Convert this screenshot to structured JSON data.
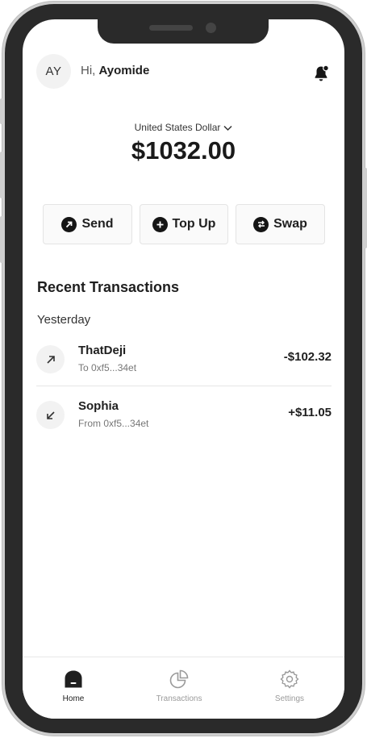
{
  "user": {
    "initials": "AY",
    "greeting_prefix": "Hi,",
    "name": "Ayomide"
  },
  "wallet": {
    "currency": "United States Dollar",
    "balance": "$1032.00"
  },
  "actions": [
    {
      "label": "Send",
      "icon": "arrow-up-right-icon"
    },
    {
      "label": "Top Up",
      "icon": "plus-icon"
    },
    {
      "label": "Swap",
      "icon": "swap-icon"
    }
  ],
  "transactions": {
    "title": "Recent Transactions",
    "group": "Yesterday",
    "items": [
      {
        "name": "ThatDeji",
        "detail": "To 0xf5...34et",
        "amount": "-$102.32",
        "direction": "outgoing"
      },
      {
        "name": "Sophia",
        "detail": "From 0xf5...34et",
        "amount": "+$11.05",
        "direction": "incoming"
      }
    ]
  },
  "nav": [
    {
      "label": "Home",
      "icon": "home-icon",
      "active": true
    },
    {
      "label": "Transactions",
      "icon": "pie-chart-icon",
      "active": false
    },
    {
      "label": "Settings",
      "icon": "gear-icon",
      "active": false
    }
  ],
  "colors": {
    "frame": "#2a2a2a",
    "active": "#1f1f1f",
    "inactive": "#9a9a9a",
    "button_bg": "#fafafa"
  }
}
